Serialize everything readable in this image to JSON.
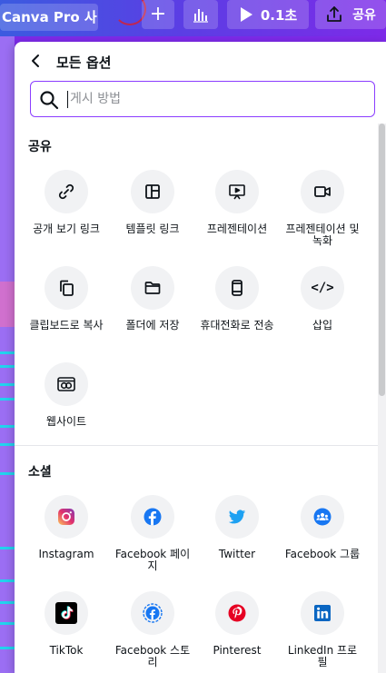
{
  "topbar": {
    "doc_title": "Canva Pro 사...",
    "add_label": "+",
    "present_label": "0.1초",
    "share_label": "공유"
  },
  "panel": {
    "title": "모든 옵션",
    "search_placeholder": "게시 방법"
  },
  "sections": {
    "share": {
      "title": "공유",
      "items": [
        {
          "label": "공개 보기 링크",
          "icon": "link-icon"
        },
        {
          "label": "템플릿 링크",
          "icon": "template-icon"
        },
        {
          "label": "프레젠테이션",
          "icon": "presentation-icon"
        },
        {
          "label": "프레젠테이션 및 녹화",
          "icon": "record-icon"
        },
        {
          "label": "클립보드로 복사",
          "icon": "copy-icon"
        },
        {
          "label": "폴더에 저장",
          "icon": "folder-icon"
        },
        {
          "label": "휴대전화로 전송",
          "icon": "phone-icon"
        },
        {
          "label": "삽입",
          "icon": "embed-icon"
        },
        {
          "label": "웹사이트",
          "icon": "website-icon"
        }
      ]
    },
    "social": {
      "title": "소셜",
      "items": [
        {
          "label": "Instagram",
          "icon": "instagram-icon"
        },
        {
          "label": "Facebook 페이지",
          "icon": "facebook-icon"
        },
        {
          "label": "Twitter",
          "icon": "twitter-icon"
        },
        {
          "label": "Facebook 그룹",
          "icon": "facebook-group-icon"
        },
        {
          "label": "TikTok",
          "icon": "tiktok-icon"
        },
        {
          "label": "Facebook 스토리",
          "icon": "facebook-story-icon"
        },
        {
          "label": "Pinterest",
          "icon": "pinterest-icon"
        },
        {
          "label": "LinkedIn 프로필",
          "icon": "linkedin-icon"
        }
      ]
    }
  },
  "colors": {
    "accent": "#8b3dff",
    "instagram": "#e1306c",
    "facebook": "#1877f2",
    "twitter": "#1da1f2",
    "tiktok": "#000000",
    "pinterest": "#e60023",
    "linkedin": "#0a66c2"
  }
}
